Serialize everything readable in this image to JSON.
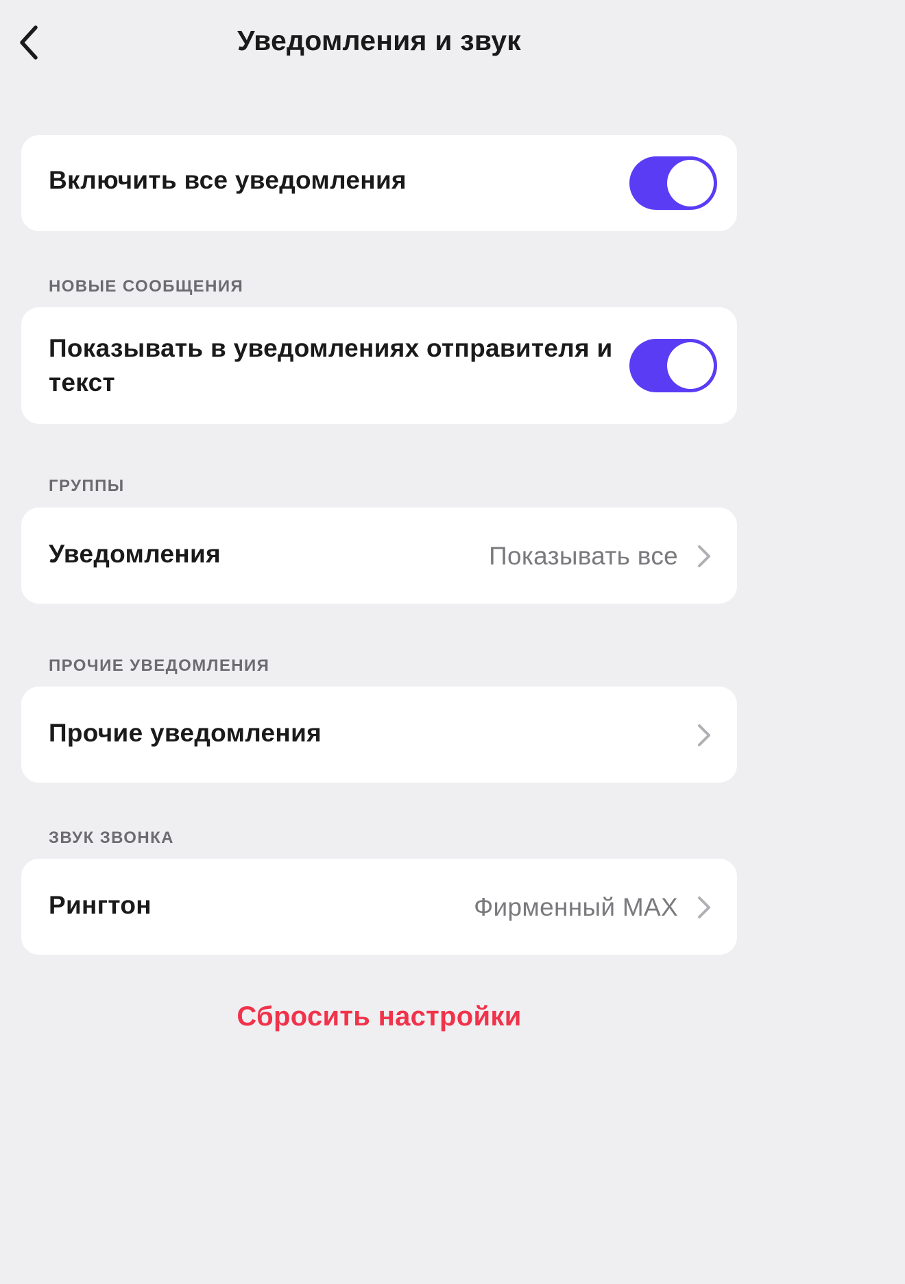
{
  "header": {
    "title": "Уведомления и звук"
  },
  "sections": [
    {
      "header": "",
      "rows": [
        {
          "label": "Включить все уведомления",
          "control": "toggle",
          "value": true
        }
      ]
    },
    {
      "header": "НОВЫЕ СООБЩЕНИЯ",
      "rows": [
        {
          "label": "Показывать в уведомлениях отправителя и текст",
          "control": "toggle",
          "value": true
        }
      ]
    },
    {
      "header": "ГРУППЫ",
      "rows": [
        {
          "label": "Уведомления",
          "control": "disclosure",
          "value": "Показывать все"
        }
      ]
    },
    {
      "header": "ПРОЧИЕ УВЕДОМЛЕНИЯ",
      "rows": [
        {
          "label": "Прочие уведомления",
          "control": "disclosure",
          "value": ""
        }
      ]
    },
    {
      "header": "ЗВУК ЗВОНКА",
      "rows": [
        {
          "label": "Рингтон",
          "control": "disclosure",
          "value": "Фирменный MAX"
        }
      ]
    }
  ],
  "footer": {
    "reset_label": "Сбросить настройки"
  },
  "icons": {
    "back": "chevron-left-icon",
    "disclosure": "chevron-right-icon"
  },
  "colors": {
    "background": "#efeff2",
    "card": "#ffffff",
    "toggle_on": "#5a3cf5",
    "destructive": "#f0334a",
    "secondary_text": "#7a7a7e",
    "section_header": "#6c6c70"
  }
}
